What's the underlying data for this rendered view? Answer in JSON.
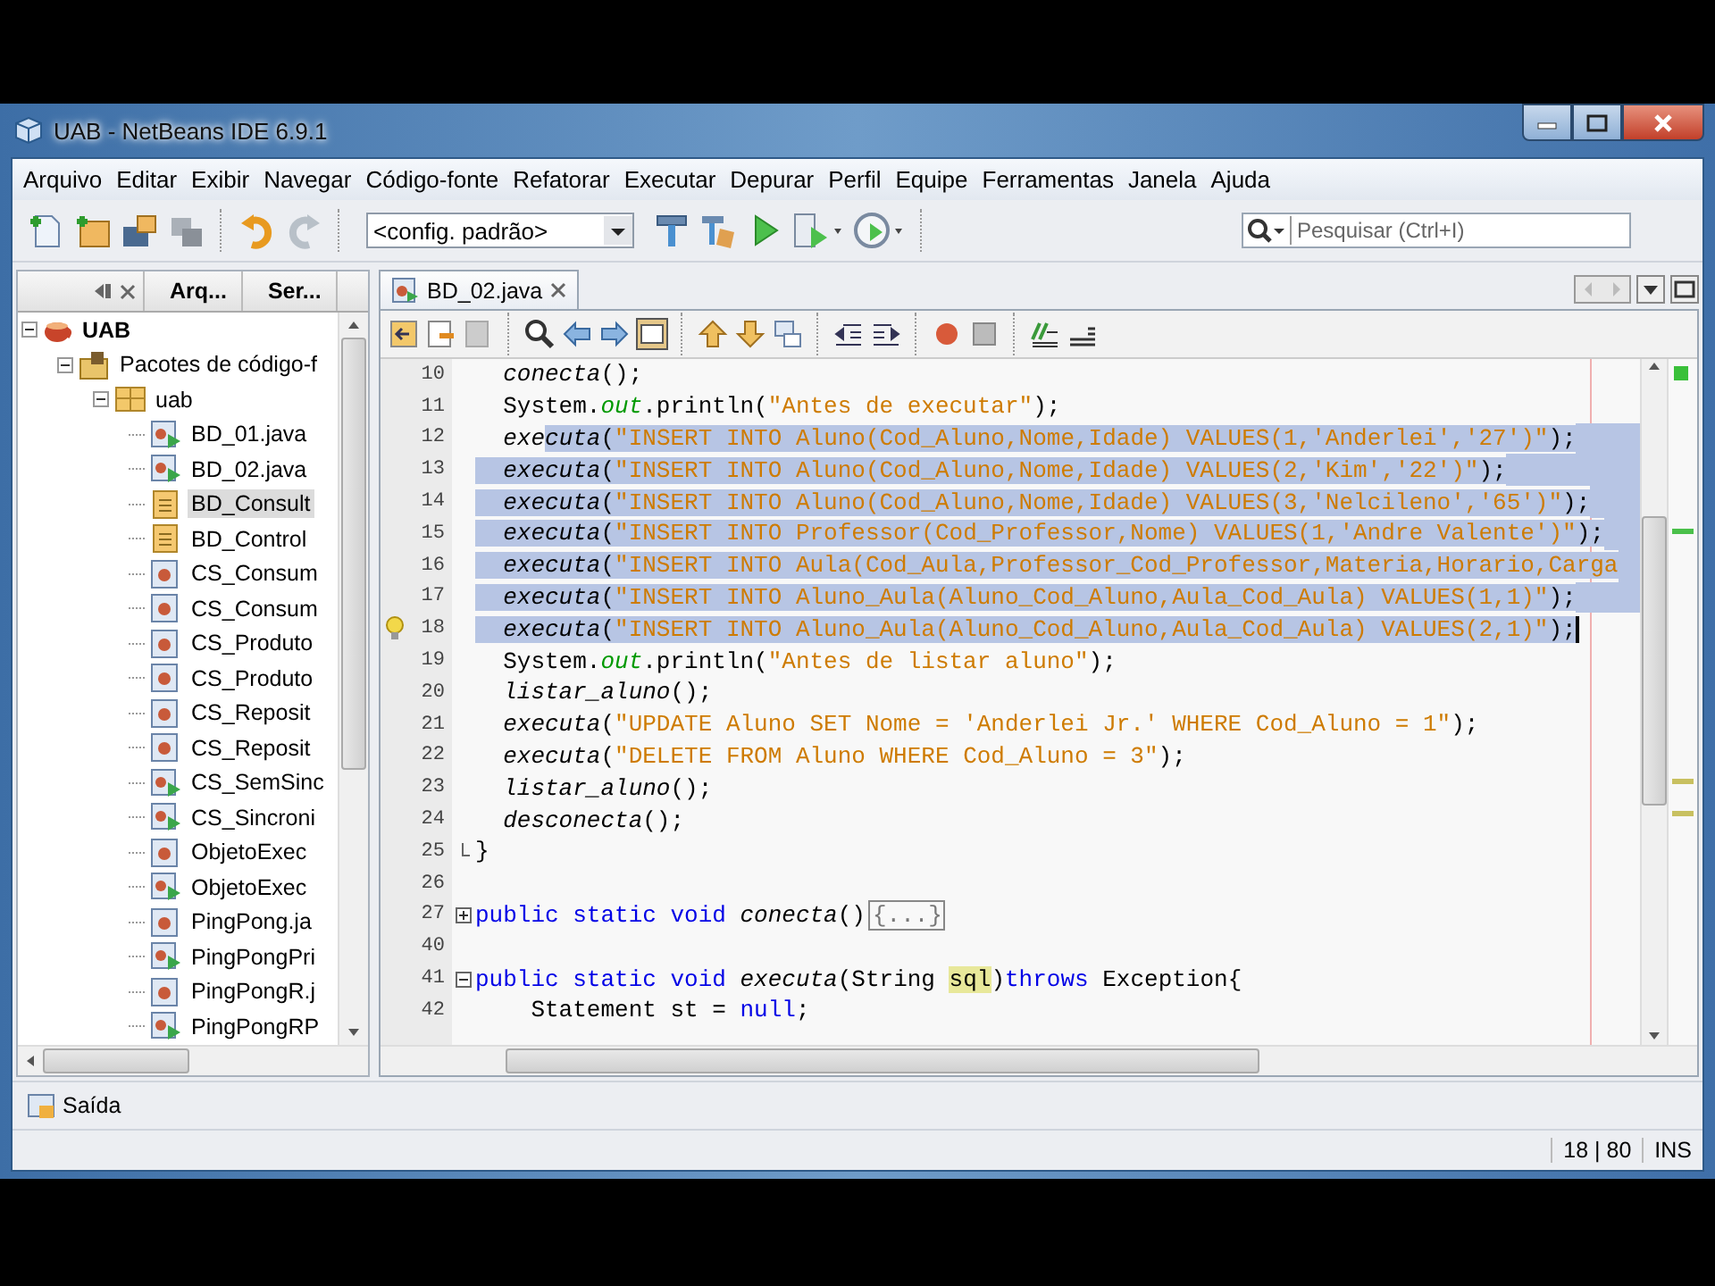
{
  "window": {
    "title": "UAB - NetBeans IDE 6.9.1"
  },
  "menu": [
    "Arquivo",
    "Editar",
    "Exibir",
    "Navegar",
    "Código-fonte",
    "Refatorar",
    "Executar",
    "Depurar",
    "Perfil",
    "Equipe",
    "Ferramentas",
    "Janela",
    "Ajuda"
  ],
  "toolbar": {
    "config": "<config. padrão>",
    "search": {
      "placeholder": "Pesquisar (Ctrl+I)"
    }
  },
  "projects_panel": {
    "tabs": [
      {
        "label": "Arq...",
        "selected": false
      },
      {
        "label": "Ser...",
        "selected": false
      }
    ],
    "tree": [
      {
        "label": "UAB",
        "kind": "project",
        "expanded": true,
        "selected": false,
        "children": [
          {
            "label": "Pacotes de código-f",
            "kind": "source_folder",
            "expanded": true,
            "selected": false,
            "children": [
              {
                "label": "uab",
                "kind": "package",
                "expanded": true,
                "selected": false,
                "children": [
                  {
                    "label": "BD_01.java",
                    "kind": "runnable",
                    "selected": false
                  },
                  {
                    "label": "BD_02.java",
                    "kind": "runnable",
                    "selected": false
                  },
                  {
                    "label": "BD_Consult",
                    "kind": "form",
                    "selected": true
                  },
                  {
                    "label": "BD_Control",
                    "kind": "form",
                    "selected": false
                  },
                  {
                    "label": "CS_Consum",
                    "kind": "class",
                    "selected": false
                  },
                  {
                    "label": "CS_Consum",
                    "kind": "class",
                    "selected": false
                  },
                  {
                    "label": "CS_Produto",
                    "kind": "class",
                    "selected": false
                  },
                  {
                    "label": "CS_Produto",
                    "kind": "class",
                    "selected": false
                  },
                  {
                    "label": "CS_Reposit",
                    "kind": "class",
                    "selected": false
                  },
                  {
                    "label": "CS_Reposit",
                    "kind": "class",
                    "selected": false
                  },
                  {
                    "label": "CS_SemSinc",
                    "kind": "runnable",
                    "selected": false
                  },
                  {
                    "label": "CS_Sincroni",
                    "kind": "runnable",
                    "selected": false
                  },
                  {
                    "label": "ObjetoExec",
                    "kind": "class",
                    "selected": false
                  },
                  {
                    "label": "ObjetoExec",
                    "kind": "runnable",
                    "selected": false
                  },
                  {
                    "label": "PingPong.ja",
                    "kind": "class",
                    "selected": false
                  },
                  {
                    "label": "PingPongPri",
                    "kind": "runnable",
                    "selected": false
                  },
                  {
                    "label": "PingPongR.j",
                    "kind": "class",
                    "selected": false
                  },
                  {
                    "label": "PingPongRP",
                    "kind": "runnable",
                    "selected": false
                  }
                ]
              }
            ]
          }
        ]
      }
    ]
  },
  "editor": {
    "tabs": [
      {
        "label": "BD_02.java",
        "selected": true
      }
    ],
    "lines": [
      {
        "number": "10",
        "selected": false,
        "tokens": [
          {
            "text": "  conecta",
            "kind": "method"
          },
          {
            "text": "();",
            "kind": "plain"
          }
        ]
      },
      {
        "number": "11",
        "selected": false,
        "tokens": [
          {
            "text": "  System.",
            "kind": "plain"
          },
          {
            "text": "out",
            "kind": "field"
          },
          {
            "text": ".println(",
            "kind": "plain"
          },
          {
            "text": "\"Antes de executar\"",
            "kind": "string"
          },
          {
            "text": ");",
            "kind": "plain"
          }
        ]
      },
      {
        "number": "12",
        "selected": true,
        "tokens": [
          {
            "text": "  exe",
            "kind": "method",
            "selected": false
          },
          {
            "text": "cuta",
            "kind": "method",
            "selected": true
          },
          {
            "text": "(",
            "kind": "plain"
          },
          {
            "text": "\"INSERT INTO Aluno(Cod_Aluno,Nome,Idade) VALUES(1,'Anderlei','27')\"",
            "kind": "string"
          },
          {
            "text": ");",
            "kind": "plain"
          }
        ]
      },
      {
        "number": "13",
        "selected": true,
        "tokens": [
          {
            "text": "  executa",
            "kind": "method"
          },
          {
            "text": "(",
            "kind": "plain"
          },
          {
            "text": "\"INSERT INTO Aluno(Cod_Aluno,Nome,Idade) VALUES(2,'Kim','22')\"",
            "kind": "string"
          },
          {
            "text": ");",
            "kind": "plain"
          }
        ]
      },
      {
        "number": "14",
        "selected": true,
        "tokens": [
          {
            "text": "  executa",
            "kind": "method"
          },
          {
            "text": "(",
            "kind": "plain"
          },
          {
            "text": "\"INSERT INTO Aluno(Cod_Aluno,Nome,Idade) VALUES(3,'Nelcileno','65')\"",
            "kind": "string"
          },
          {
            "text": ");",
            "kind": "plain"
          }
        ]
      },
      {
        "number": "15",
        "selected": true,
        "tokens": [
          {
            "text": "  executa",
            "kind": "method"
          },
          {
            "text": "(",
            "kind": "plain"
          },
          {
            "text": "\"INSERT INTO Professor(Cod_Professor,Nome) VALUES(1,'Andre Valente')\"",
            "kind": "string"
          },
          {
            "text": ");",
            "kind": "plain"
          }
        ]
      },
      {
        "number": "16",
        "selected": true,
        "tokens": [
          {
            "text": "  executa",
            "kind": "method"
          },
          {
            "text": "(",
            "kind": "plain"
          },
          {
            "text": "\"INSERT INTO Aula(Cod_Aula,Professor_Cod_Professor,Materia,Horario,Carga",
            "kind": "string"
          }
        ]
      },
      {
        "number": "17",
        "selected": true,
        "tokens": [
          {
            "text": "  executa",
            "kind": "method"
          },
          {
            "text": "(",
            "kind": "plain"
          },
          {
            "text": "\"INSERT INTO Aluno_Aula(Aluno_Cod_Aluno,Aula_Cod_Aula) VALUES(1,1)\"",
            "kind": "string"
          },
          {
            "text": ");",
            "kind": "plain"
          }
        ]
      },
      {
        "number": "18",
        "selected": true,
        "caret": true,
        "hint": true,
        "tokens": [
          {
            "text": "  executa",
            "kind": "method"
          },
          {
            "text": "(",
            "kind": "plain"
          },
          {
            "text": "\"INSERT INTO Aluno_Aula(Aluno_Cod_Aluno,Aula_Cod_Aula) VALUES(2,1)\"",
            "kind": "string"
          },
          {
            "text": ");",
            "kind": "plain"
          }
        ]
      },
      {
        "number": "19",
        "selected": false,
        "tokens": [
          {
            "text": "  System.",
            "kind": "plain"
          },
          {
            "text": "out",
            "kind": "field"
          },
          {
            "text": ".println(",
            "kind": "plain"
          },
          {
            "text": "\"Antes de listar aluno\"",
            "kind": "string"
          },
          {
            "text": ");",
            "kind": "plain"
          }
        ]
      },
      {
        "number": "20",
        "selected": false,
        "tokens": [
          {
            "text": "  listar_aluno",
            "kind": "method"
          },
          {
            "text": "();",
            "kind": "plain"
          }
        ]
      },
      {
        "number": "21",
        "selected": false,
        "tokens": [
          {
            "text": "  executa",
            "kind": "method"
          },
          {
            "text": "(",
            "kind": "plain"
          },
          {
            "text": "\"UPDATE Aluno SET Nome = 'Anderlei Jr.' WHERE Cod_Aluno = 1\"",
            "kind": "string"
          },
          {
            "text": ");",
            "kind": "plain"
          }
        ]
      },
      {
        "number": "22",
        "selected": false,
        "tokens": [
          {
            "text": "  executa",
            "kind": "method"
          },
          {
            "text": "(",
            "kind": "plain"
          },
          {
            "text": "\"DELETE FROM Aluno WHERE Cod_Aluno = 3\"",
            "kind": "string"
          },
          {
            "text": ");",
            "kind": "plain"
          }
        ]
      },
      {
        "number": "23",
        "selected": false,
        "tokens": [
          {
            "text": "  listar_aluno",
            "kind": "method"
          },
          {
            "text": "();",
            "kind": "plain"
          }
        ]
      },
      {
        "number": "24",
        "selected": false,
        "tokens": [
          {
            "text": "  desconecta",
            "kind": "method"
          },
          {
            "text": "();",
            "kind": "plain"
          }
        ]
      },
      {
        "number": "25",
        "selected": false,
        "kind": "fold_end",
        "tokens": [
          {
            "text": "}",
            "kind": "plain"
          }
        ]
      },
      {
        "number": "26",
        "selected": false
      },
      {
        "number": "27",
        "selected": false,
        "kind": "fold_collapsed",
        "tokens": [
          {
            "text": "public static void",
            "kind": "keyword"
          },
          {
            "text": " conecta",
            "kind": "method"
          },
          {
            "text": "()",
            "kind": "plain"
          },
          {
            "text": "{...}",
            "kind": "folded"
          }
        ]
      },
      {
        "number": "40",
        "selected": false
      },
      {
        "number": "41",
        "selected": false,
        "kind": "fold_expanded",
        "tokens": [
          {
            "text": "public static void",
            "kind": "keyword"
          },
          {
            "text": " executa",
            "kind": "method"
          },
          {
            "text": "(String ",
            "kind": "plain"
          },
          {
            "text": "sql",
            "kind": "mark"
          },
          {
            "text": ")",
            "kind": "plain"
          },
          {
            "text": "throws",
            "kind": "keyword"
          },
          {
            "text": " Exception{",
            "kind": "plain"
          }
        ]
      },
      {
        "number": "42",
        "selected": false,
        "tokens": [
          {
            "text": "    Statement st = ",
            "kind": "plain"
          },
          {
            "text": "null",
            "kind": "keyword"
          },
          {
            "text": ";",
            "kind": "plain"
          }
        ]
      }
    ]
  },
  "output_panel": {
    "label": "Saída"
  },
  "status_bar": {
    "position": "18 | 80",
    "mode": "INS"
  }
}
